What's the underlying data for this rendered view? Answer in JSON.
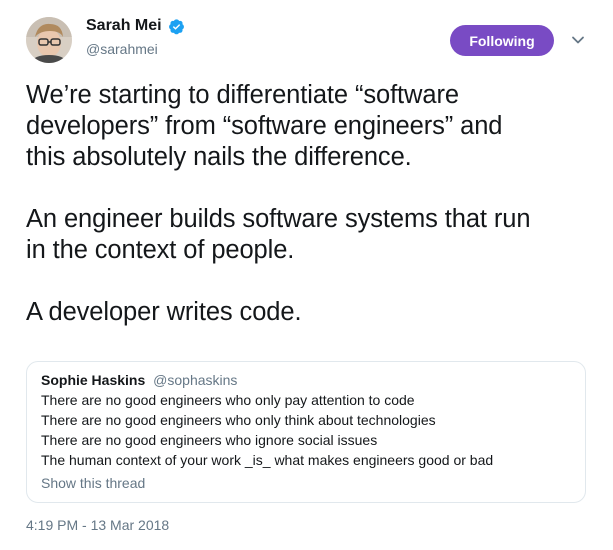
{
  "author": {
    "name": "Sarah Mei",
    "handle": "@sarahmei",
    "verified": true,
    "avatar_icon": "profile-photo"
  },
  "follow_button": {
    "label": "Following",
    "color": "#794bc4"
  },
  "menu_icon": "chevron-down-icon",
  "tweet": {
    "lines": [
      "We’re starting to differentiate “software",
      "developers” from “software engineers” and",
      "this absolutely nails the difference.",
      "An engineer builds software systems that run",
      "in the context of people.",
      "A developer writes code."
    ]
  },
  "quoted_tweet": {
    "name": "Sophie Haskins",
    "handle": "@sophaskins",
    "lines": [
      "There are no good engineers who only pay attention to code",
      "There are no good engineers who only think about technologies",
      "There are no good engineers who ignore social issues",
      "The human context of your work _is_ what makes engineers good or bad"
    ],
    "show_thread": "Show this thread"
  },
  "timestamp": "4:19 PM - 13 Mar 2018",
  "colors": {
    "text": "#14171a",
    "secondary": "#657786",
    "border": "#e1e8ed",
    "verified": "#1da1f2"
  }
}
